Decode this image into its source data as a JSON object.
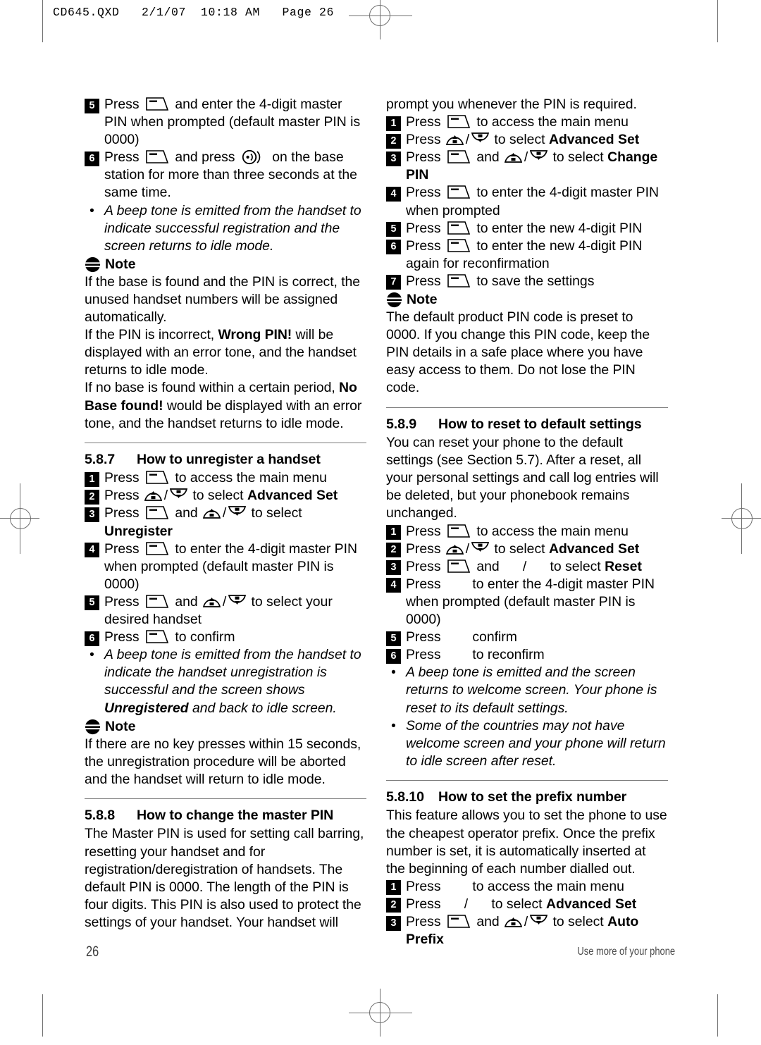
{
  "header": {
    "slug": "CD645.QXD   2/1/07  10:18 AM   Page 26"
  },
  "footer": {
    "page_number": "26",
    "running_text": "Use more of your phone"
  },
  "icons": {
    "softkey": "softkey-icon",
    "nav_up": "nav-up-key-icon",
    "nav_down": "nav-down-key-icon",
    "paging": "base-station-paging-icon",
    "note": "note-icon"
  },
  "left_column": {
    "steps_registration": [
      {
        "num": "5",
        "parts": [
          {
            "t": "text",
            "v": "Press "
          },
          {
            "t": "icon",
            "v": "softkey"
          },
          {
            "t": "text",
            "v": " and enter the 4-digit master PIN when prompted (default master PIN is 0000)"
          }
        ]
      },
      {
        "num": "6",
        "parts": [
          {
            "t": "text",
            "v": "Press "
          },
          {
            "t": "icon",
            "v": "softkey"
          },
          {
            "t": "text",
            "v": " and press "
          },
          {
            "t": "icon",
            "v": "paging"
          },
          {
            "t": "text",
            "v": " on the base station for more than three seconds at the same time."
          }
        ]
      }
    ],
    "bullet_registration": "A beep tone is emitted from the handset to indicate successful registration and the screen returns to idle mode.",
    "note_1": {
      "label": "Note",
      "paragraphs": [
        [
          {
            "t": "text",
            "v": "If the base is found and the PIN is correct, the unused handset numbers will be assigned automatically."
          }
        ],
        [
          {
            "t": "text",
            "v": "If the PIN is incorrect, "
          },
          {
            "t": "bold",
            "v": "Wrong PIN!"
          },
          {
            "t": "text",
            "v": " will be displayed with an error tone, and the handset returns to idle mode."
          }
        ],
        [
          {
            "t": "text",
            "v": "If no base is found within a certain period, "
          },
          {
            "t": "bold",
            "v": "No Base found!"
          },
          {
            "t": "text",
            "v": " would be displayed with an error tone, and the handset returns to idle mode."
          }
        ]
      ]
    },
    "section_587": {
      "number": "5.8.7",
      "title": "How to unregister a handset",
      "steps": [
        {
          "num": "1",
          "parts": [
            {
              "t": "text",
              "v": "Press "
            },
            {
              "t": "icon",
              "v": "softkey"
            },
            {
              "t": "text",
              "v": " to access the main menu"
            }
          ]
        },
        {
          "num": "2",
          "parts": [
            {
              "t": "text",
              "v": "Press "
            },
            {
              "t": "icon",
              "v": "nav_up"
            },
            {
              "t": "slash",
              "v": "/"
            },
            {
              "t": "icon",
              "v": "nav_down"
            },
            {
              "t": "text",
              "v": " to select "
            },
            {
              "t": "bold",
              "v": "Advanced Set"
            }
          ]
        },
        {
          "num": "3",
          "parts": [
            {
              "t": "text",
              "v": "Press "
            },
            {
              "t": "icon",
              "v": "softkey"
            },
            {
              "t": "text",
              "v": " and "
            },
            {
              "t": "icon",
              "v": "nav_up"
            },
            {
              "t": "slash",
              "v": "/"
            },
            {
              "t": "icon",
              "v": "nav_down"
            },
            {
              "t": "text",
              "v": " to select "
            },
            {
              "t": "bold",
              "v": "Unregister"
            }
          ]
        },
        {
          "num": "4",
          "parts": [
            {
              "t": "text",
              "v": "Press "
            },
            {
              "t": "icon",
              "v": "softkey"
            },
            {
              "t": "text",
              "v": " to enter the 4-digit master PIN when prompted (default master PIN is 0000)"
            }
          ]
        },
        {
          "num": "5",
          "parts": [
            {
              "t": "text",
              "v": "Press "
            },
            {
              "t": "icon",
              "v": "softkey"
            },
            {
              "t": "text",
              "v": " and "
            },
            {
              "t": "icon",
              "v": "nav_up"
            },
            {
              "t": "slash",
              "v": "/"
            },
            {
              "t": "icon",
              "v": "nav_down"
            },
            {
              "t": "text",
              "v": " to select your desired handset"
            }
          ]
        },
        {
          "num": "6",
          "parts": [
            {
              "t": "text",
              "v": "Press "
            },
            {
              "t": "icon",
              "v": "softkey"
            },
            {
              "t": "text",
              "v": " to confirm"
            }
          ]
        }
      ],
      "bullet": [
        {
          "t": "text",
          "v": "A beep tone is emitted from the handset to indicate the handset unregistration is successful and the screen shows "
        },
        {
          "t": "bold",
          "v": "Unregistered"
        },
        {
          "t": "text",
          "v": " and back to idle screen."
        }
      ],
      "note": {
        "label": "Note",
        "text": "If there are no key presses within 15 seconds, the unregistration procedure will be aborted and the handset will return to idle mode."
      }
    },
    "section_588": {
      "number": "5.8.8",
      "title": "How to change the master PIN",
      "intro": "The Master PIN is used for setting call barring, resetting your handset and for registration/deregistration of handsets. The default PIN is 0000. The length of the PIN is four digits. This PIN is also used to protect the settings of your handset. Your handset will"
    }
  },
  "right_column": {
    "continued_intro": "prompt you whenever the PIN is required.",
    "section_588_steps": [
      {
        "num": "1",
        "parts": [
          {
            "t": "text",
            "v": "Press "
          },
          {
            "t": "icon",
            "v": "softkey"
          },
          {
            "t": "text",
            "v": " to access the main menu"
          }
        ]
      },
      {
        "num": "2",
        "parts": [
          {
            "t": "text",
            "v": "Press "
          },
          {
            "t": "icon",
            "v": "nav_up"
          },
          {
            "t": "slash",
            "v": "/"
          },
          {
            "t": "icon",
            "v": "nav_down"
          },
          {
            "t": "text",
            "v": " to select "
          },
          {
            "t": "bold",
            "v": "Advanced Set"
          }
        ]
      },
      {
        "num": "3",
        "parts": [
          {
            "t": "text",
            "v": "Press "
          },
          {
            "t": "icon",
            "v": "softkey"
          },
          {
            "t": "text",
            "v": " and "
          },
          {
            "t": "icon",
            "v": "nav_up"
          },
          {
            "t": "slash",
            "v": "/"
          },
          {
            "t": "icon",
            "v": "nav_down"
          },
          {
            "t": "text",
            "v": " to select "
          },
          {
            "t": "bold",
            "v": "Change PIN"
          }
        ]
      },
      {
        "num": "4",
        "parts": [
          {
            "t": "text",
            "v": "Press "
          },
          {
            "t": "icon",
            "v": "softkey"
          },
          {
            "t": "text",
            "v": " to enter the 4-digit master PIN when prompted"
          }
        ]
      },
      {
        "num": "5",
        "parts": [
          {
            "t": "text",
            "v": "Press "
          },
          {
            "t": "icon",
            "v": "softkey"
          },
          {
            "t": "text",
            "v": " to enter the new 4-digit PIN"
          }
        ]
      },
      {
        "num": "6",
        "parts": [
          {
            "t": "text",
            "v": "Press "
          },
          {
            "t": "icon",
            "v": "softkey"
          },
          {
            "t": "text",
            "v": " to enter the new 4-digit PIN again for reconfirmation"
          }
        ]
      },
      {
        "num": "7",
        "parts": [
          {
            "t": "text",
            "v": "Press "
          },
          {
            "t": "icon",
            "v": "softkey"
          },
          {
            "t": "text",
            "v": " to save the settings"
          }
        ]
      }
    ],
    "note_2": {
      "label": "Note",
      "text": "The default product PIN code is preset to 0000. If you change this PIN code, keep the PIN details in a safe place where you have easy access to them. Do not lose the PIN code."
    },
    "section_589": {
      "number": "5.8.9",
      "title": "How to reset to default settings",
      "intro": "You can reset your phone to the default settings (see Section 5.7). After a reset, all your personal settings and call log entries will be deleted, but your phonebook remains unchanged.",
      "steps": [
        {
          "num": "1",
          "parts": [
            {
              "t": "text",
              "v": "Press "
            },
            {
              "t": "icon",
              "v": "softkey"
            },
            {
              "t": "text",
              "v": " to access the main menu"
            }
          ]
        },
        {
          "num": "2",
          "parts": [
            {
              "t": "text",
              "v": "Press "
            },
            {
              "t": "icon",
              "v": "nav_up"
            },
            {
              "t": "slash",
              "v": "/"
            },
            {
              "t": "icon",
              "v": "nav_down"
            },
            {
              "t": "text",
              "v": " to select "
            },
            {
              "t": "bold",
              "v": "Advanced Set"
            }
          ]
        },
        {
          "num": "3",
          "parts": [
            {
              "t": "text",
              "v": "Press "
            },
            {
              "t": "icon",
              "v": "softkey"
            },
            {
              "t": "text",
              "v": " and "
            },
            {
              "t": "blank_nav",
              "v": ""
            },
            {
              "t": "slash",
              "v": "/"
            },
            {
              "t": "blank_nav",
              "v": ""
            },
            {
              "t": "text",
              "v": " to select "
            },
            {
              "t": "bold",
              "v": "Reset"
            }
          ]
        },
        {
          "num": "4",
          "parts": [
            {
              "t": "text",
              "v": "Press "
            },
            {
              "t": "blank",
              "v": ""
            },
            {
              "t": "text",
              "v": " to enter the 4-digit master PIN when prompted (default master PIN is 0000)"
            }
          ]
        },
        {
          "num": "5",
          "parts": [
            {
              "t": "text",
              "v": "Press "
            },
            {
              "t": "blank",
              "v": ""
            },
            {
              "t": "text",
              "v": " confirm"
            }
          ]
        },
        {
          "num": "6",
          "parts": [
            {
              "t": "text",
              "v": "Press "
            },
            {
              "t": "blank",
              "v": ""
            },
            {
              "t": "text",
              "v": " to reconfirm"
            }
          ]
        }
      ],
      "bullets": [
        "A beep tone is emitted and the screen returns to welcome screen. Your phone is reset to its default settings.",
        "Some of the countries may not have welcome screen and your phone will return to idle screen after reset."
      ]
    },
    "section_5810": {
      "number": "5.8.10",
      "title": "How to set the prefix number",
      "intro": "This feature allows you to set the phone to use the cheapest operator prefix. Once the prefix number is set, it is automatically inserted at the beginning of each number dialled out.",
      "steps": [
        {
          "num": "1",
          "parts": [
            {
              "t": "text",
              "v": "Press "
            },
            {
              "t": "blank",
              "v": ""
            },
            {
              "t": "text",
              "v": " to access the main menu"
            }
          ]
        },
        {
          "num": "2",
          "parts": [
            {
              "t": "text",
              "v": "Press "
            },
            {
              "t": "blank_nav",
              "v": ""
            },
            {
              "t": "slash",
              "v": "/"
            },
            {
              "t": "blank_nav",
              "v": ""
            },
            {
              "t": "text",
              "v": " to select "
            },
            {
              "t": "bold",
              "v": "Advanced Set"
            }
          ]
        },
        {
          "num": "3",
          "parts": [
            {
              "t": "text",
              "v": "Press "
            },
            {
              "t": "icon",
              "v": "softkey"
            },
            {
              "t": "text",
              "v": " and "
            },
            {
              "t": "icon",
              "v": "nav_up"
            },
            {
              "t": "slash",
              "v": "/"
            },
            {
              "t": "icon",
              "v": "nav_down"
            },
            {
              "t": "text",
              "v": " to select "
            },
            {
              "t": "bold",
              "v": "Auto Prefix"
            }
          ]
        }
      ]
    }
  }
}
